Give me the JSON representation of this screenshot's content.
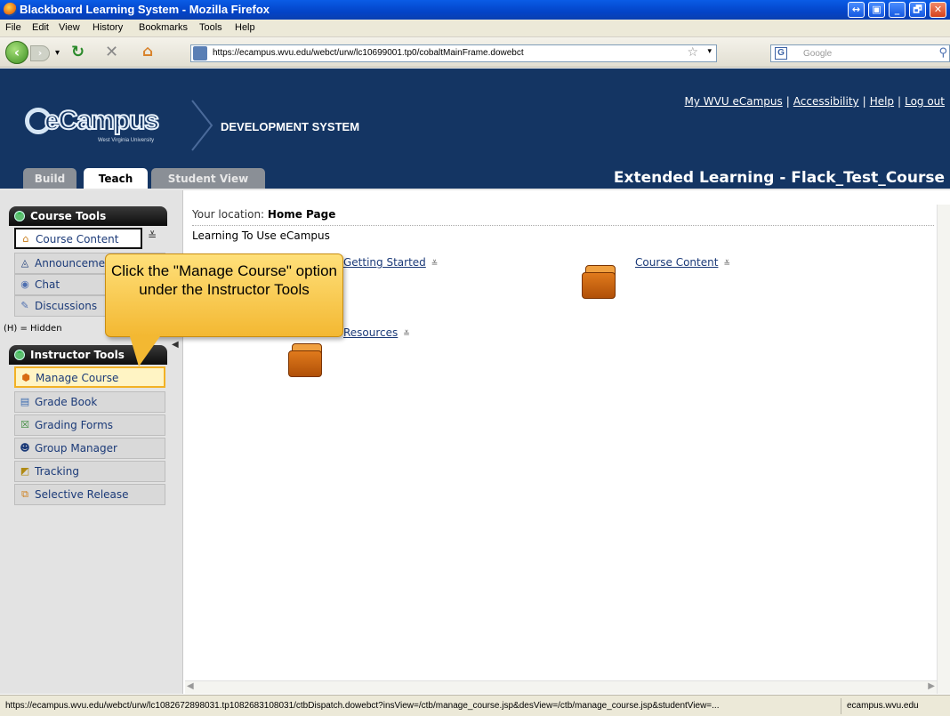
{
  "window": {
    "title": "Blackboard Learning System - Mozilla Firefox",
    "controls": [
      "↔",
      "▣",
      "_",
      "🗗",
      "✕"
    ]
  },
  "menu": [
    "File",
    "Edit",
    "View",
    "History",
    "Bookmarks",
    "Tools",
    "Help"
  ],
  "nav": {
    "url": "https://ecampus.wvu.edu/webct/urw/lc10699001.tp0/cobaltMainFrame.dowebct",
    "search_placeholder": "Google",
    "search_engine_letter": "G"
  },
  "header": {
    "links": [
      "My WVU eCampus",
      "Accessibility",
      "Help",
      "Log out"
    ],
    "logo_text": "eCampus",
    "logo_sub": "West Virginia University",
    "system": "DEVELOPMENT SYSTEM",
    "course_title": "Extended Learning - Flack_Test_Course",
    "tabs": [
      {
        "label": "Build",
        "active": false
      },
      {
        "label": "Teach",
        "active": true
      },
      {
        "label": "Student View",
        "active": false
      }
    ]
  },
  "sidebar": {
    "course_tools_title": "Course Tools",
    "course_tools": [
      {
        "label": "Course Content",
        "icon": "home-icon"
      },
      {
        "label": "Announcements",
        "icon": "announcement-icon"
      },
      {
        "label": "Chat",
        "icon": "chat-icon"
      },
      {
        "label": "Discussions",
        "icon": "discussion-icon"
      }
    ],
    "hidden_note": "(H) = Hidden",
    "instructor_tools_title": "Instructor Tools",
    "instructor_tools": [
      {
        "label": "Manage Course",
        "icon": "manage-course-icon"
      },
      {
        "label": "Grade Book",
        "icon": "grade-book-icon"
      },
      {
        "label": "Grading Forms",
        "icon": "grading-forms-icon"
      },
      {
        "label": "Group Manager",
        "icon": "group-manager-icon"
      },
      {
        "label": "Tracking",
        "icon": "tracking-icon"
      },
      {
        "label": "Selective Release",
        "icon": "selective-release-icon"
      }
    ]
  },
  "content": {
    "location_label": "Your location:",
    "location": "Home Page",
    "subtitle": "Learning To Use eCampus",
    "folders": [
      "Getting Started",
      "Course Content",
      "Resources"
    ]
  },
  "callout": {
    "text": "Click the \"Manage Course\" option under the Instructor Tools"
  },
  "status": {
    "message": "https://ecampus.wvu.edu/webct/urw/lc1082672898031.tp1082683108031/ctbDispatch.dowebct?insView=/ctb/manage_course.jsp&desView=/ctb/manage_course.jsp&studentView=...",
    "domain": "ecampus.wvu.edu"
  },
  "colors": {
    "header_bg": "#143563",
    "callout_bg": "#f3b832",
    "highlight_border": "#f2b124",
    "link": "#1b3a78"
  }
}
